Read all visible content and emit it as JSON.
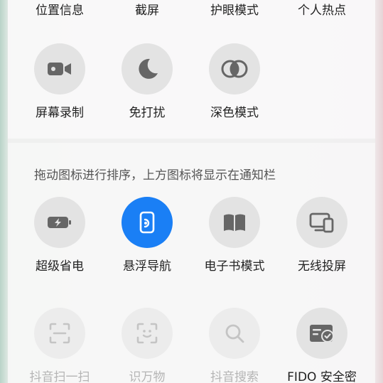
{
  "top_row_labels": [
    "位置信息",
    "截屏",
    "护眼模式",
    "个人热点"
  ],
  "active_tiles": [
    {
      "label": "屏幕录制",
      "icon": "video-camera-icon"
    },
    {
      "label": "免打扰",
      "icon": "moon-icon"
    },
    {
      "label": "深色模式",
      "icon": "dark-mode-icon"
    }
  ],
  "sort_hint": "拖动图标进行排序，上方图标将显示在通知栏",
  "inactive_tiles_row1": [
    {
      "label": "超级省电",
      "icon": "battery-saver-icon",
      "state": "off"
    },
    {
      "label": "悬浮导航",
      "icon": "floating-navigation-icon",
      "state": "on"
    },
    {
      "label": "电子书模式",
      "icon": "book-icon",
      "state": "off"
    },
    {
      "label": "无线投屏",
      "icon": "screen-cast-icon",
      "state": "off"
    }
  ],
  "inactive_tiles_row2": [
    {
      "label": "抖音扫一扫",
      "icon": "scan-icon",
      "state": "disabled"
    },
    {
      "label": "识万物",
      "icon": "recognize-icon",
      "state": "disabled"
    },
    {
      "label": "抖音搜索",
      "icon": "search-icon",
      "state": "disabled"
    },
    {
      "label": "FIDO 安全密",
      "icon": "security-key-icon",
      "state": "off"
    }
  ],
  "colors": {
    "accent": "#1a7ff5",
    "tile_bg": "#e3e3e3",
    "icon": "#666666",
    "disabled_icon": "#c4c4c4"
  }
}
